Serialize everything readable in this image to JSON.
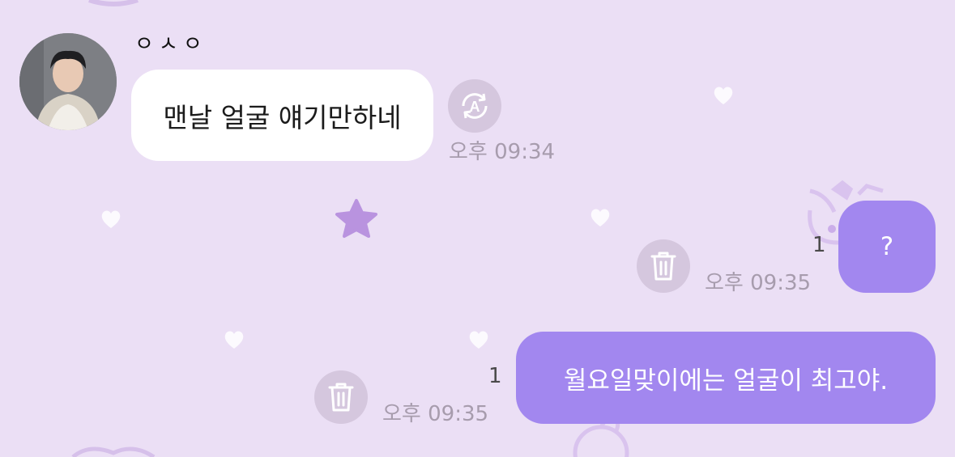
{
  "chat": {
    "incoming": {
      "sender_name": "ㅇㅅㅇ",
      "message": "맨날 얼굴 얘기만하네",
      "time": "오후 09:34",
      "action_icon": "translate-icon"
    },
    "outgoing": [
      {
        "message": "?",
        "unread_count": "1",
        "time": "오후 09:35",
        "action_icon": "trash-icon"
      },
      {
        "message": "월요일맞이에는 얼굴이 최고야.",
        "unread_count": "1",
        "time": "오후 09:35",
        "action_icon": "trash-icon"
      }
    ]
  },
  "theme": {
    "background": "#ebdff5",
    "incoming_bubble": "#ffffff",
    "outgoing_bubble": "#a287ef",
    "action_button": "#d5c7de",
    "time_text": "#a79cad"
  }
}
